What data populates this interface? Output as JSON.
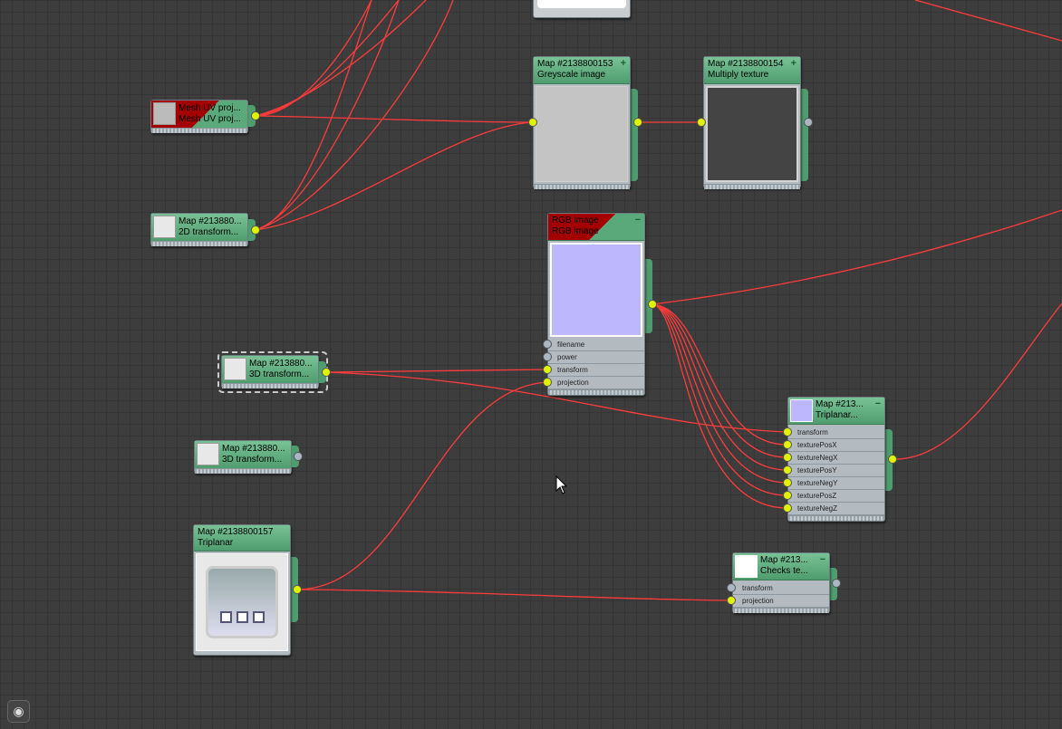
{
  "nodes": {
    "greyscale": {
      "title": "Map #2138800153",
      "subtitle": "Greyscale image",
      "button": "+"
    },
    "multiply": {
      "title": "Map #2138800154",
      "subtitle": "Multiply texture",
      "button": "+"
    },
    "mesh_uv": {
      "title": "Mesh UV proj...",
      "subtitle": "Mesh UV proj..."
    },
    "transform2d": {
      "title": "Map #213880...",
      "subtitle": "2D transform..."
    },
    "rgb": {
      "title": "RGB image",
      "subtitle": "RGB image",
      "button": "−",
      "params": [
        "filename",
        "power",
        "transform",
        "projection"
      ]
    },
    "transform3d_a": {
      "title": "Map #213880...",
      "subtitle": "3D transform..."
    },
    "transform3d_b": {
      "title": "Map #213880...",
      "subtitle": "3D transform..."
    },
    "triplanar_big": {
      "title": "Map #2138800157",
      "subtitle": "Triplanar"
    },
    "triplanar_small": {
      "title": "Map #213...",
      "subtitle": "Triplanar...",
      "button": "−",
      "params": [
        "transform",
        "texturePosX",
        "textureNegX",
        "texturePosY",
        "textureNegY",
        "texturePosZ",
        "textureNegZ"
      ]
    },
    "checks": {
      "title": "Map #213...",
      "subtitle": "Checks te...",
      "button": "−",
      "params": [
        "transform",
        "projection"
      ]
    }
  },
  "colors": {
    "wire": "#ff3b3b",
    "node_header": "#5aa97a",
    "port_active": "#dff200",
    "port_inactive": "#aab6c2",
    "rgb_preview": "#bdb8fe",
    "error_header": "#a40000"
  },
  "icons": {
    "finder": "binoculars-icon",
    "cursor": "mouse-pointer-icon"
  }
}
